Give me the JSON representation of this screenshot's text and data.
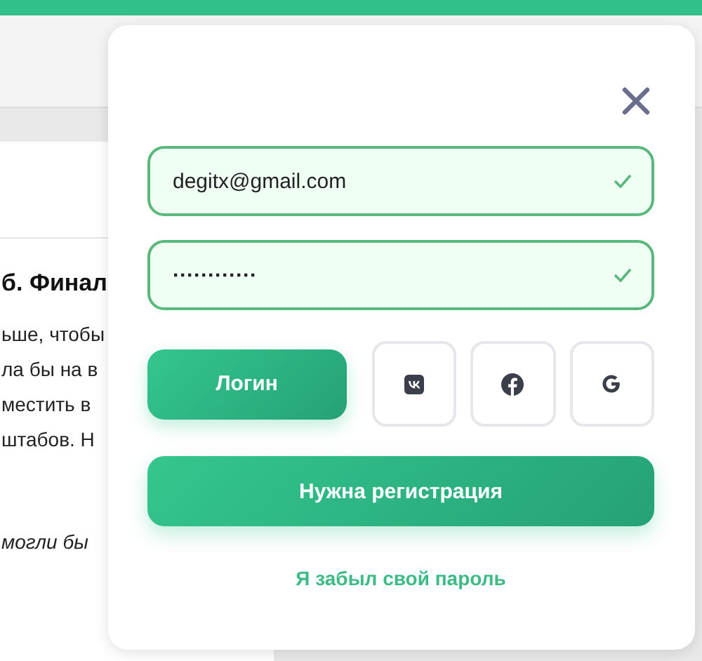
{
  "background_article": {
    "heading": "б. Финал",
    "lines": [
      "ьше, чтобы",
      "ла бы на в",
      "местить в",
      "штабов. Н"
    ],
    "italic_line": "могли бы"
  },
  "login_dialog": {
    "fields": [
      {
        "kind": "text",
        "value": "degitx@gmail.com",
        "valid": true
      },
      {
        "kind": "password",
        "value": "············",
        "valid": true
      }
    ],
    "login_button": "Логин",
    "social_buttons": [
      {
        "kind": "vk"
      },
      {
        "kind": "facebook"
      },
      {
        "kind": "google"
      }
    ],
    "register_button": "Нужна регистрация",
    "forgot_link": "Я забыл свой пароль"
  }
}
